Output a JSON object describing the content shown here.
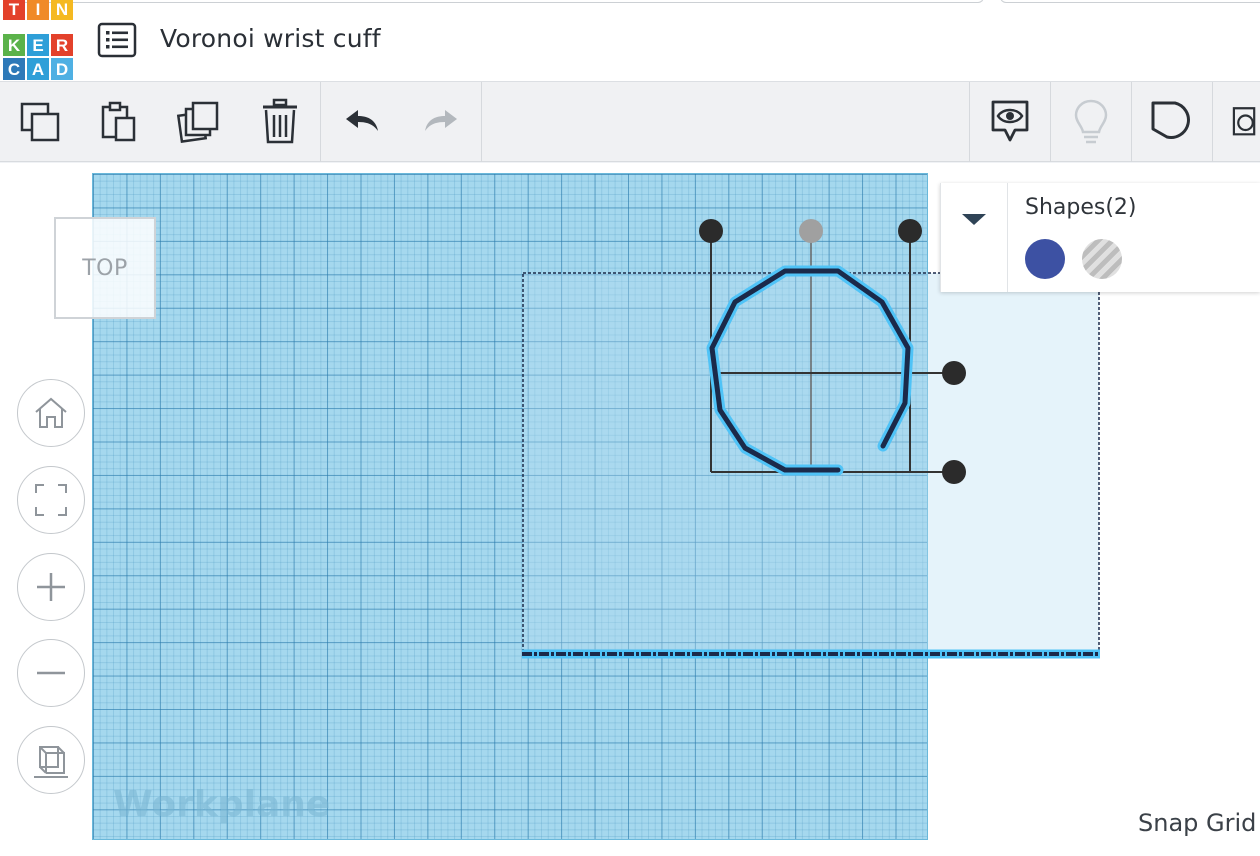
{
  "app": {
    "logo_letters": [
      "T",
      "I",
      "N",
      "K",
      "E",
      "R",
      "C",
      "A",
      "D"
    ],
    "logo_colors": [
      "#e3412b",
      "#f08a28",
      "#f5b921",
      "#5bb24a",
      "#2e9fd8",
      "#e3412b",
      "#2e79b8",
      "#2e9fd8",
      "#4fb0e3"
    ],
    "design_title": "Voronoi wrist cuff"
  },
  "toolbar": {
    "icons": [
      "copy-icon",
      "paste-icon",
      "duplicate-icon",
      "delete-icon",
      "undo-icon",
      "redo-icon",
      "notes-icon",
      "lightbulb-icon",
      "shape-icon",
      "shape-icon-2"
    ]
  },
  "viewport": {
    "view_cube_label": "TOP",
    "workplane_label": "Workplane",
    "workplane_color": "#a5d8ee",
    "selection_color": "#1b2a4a",
    "highlight_color": "#4fc3f7",
    "nav_icons": [
      "home-icon",
      "fit-view-icon",
      "zoom-in-icon",
      "zoom-out-icon",
      "ortho-view-icon"
    ]
  },
  "shapes_panel": {
    "title": "Shapes(2)",
    "solid_color": "#3d51a3",
    "hole_label_icon": "hole-swatch"
  },
  "status": {
    "snap_grid_label": "Snap Grid"
  }
}
